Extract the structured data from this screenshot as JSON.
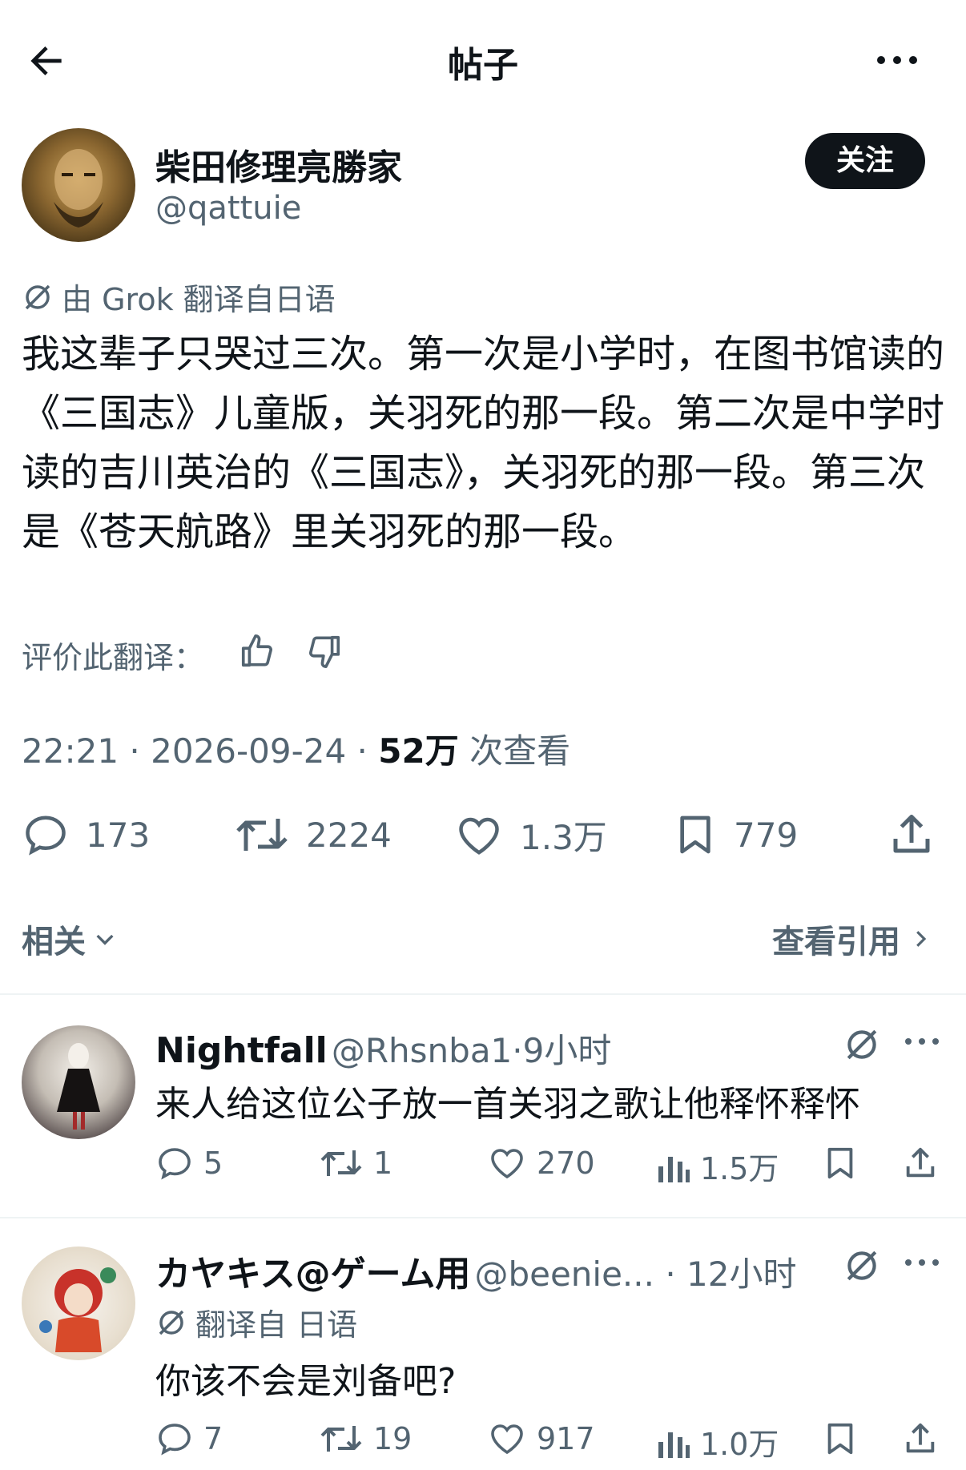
{
  "header": {
    "title": "帖子"
  },
  "author": {
    "name": "柴田修理亮勝家",
    "handle": "@qattuie",
    "follow_label": "关注"
  },
  "translation_note": "由 Grok 翻译自日语",
  "tweet": {
    "text": "我这辈子只哭过三次。第一次是小学时，在图书馆读的《三国志》儿童版，关羽死的那一段。第二次是中学时读的吉川英治的《三国志》，关羽死的那一段。第三次是《苍天航路》里关羽死的那一段。",
    "rate_label": "评价此翻译：",
    "time": "22:21",
    "date": "2026-09-24",
    "views": "52万",
    "views_label": "次查看"
  },
  "stats": {
    "replies": "173",
    "retweets": "2224",
    "likes": "1.3万",
    "bookmarks": "779"
  },
  "related": {
    "label": "相关",
    "quotes_label": "查看引用"
  },
  "replies": [
    {
      "name": "Nightfall",
      "handle": "@Rhsnba1",
      "time": "9小时",
      "text": "来人给这位公子放一首关羽之歌让他释怀释怀",
      "stats": {
        "replies": "5",
        "retweets": "1",
        "likes": "270",
        "views": "1.5万"
      }
    },
    {
      "name": "カヤキス@ゲーム用",
      "handle": "@beenie...",
      "time": "12小时",
      "translation_note": "翻译自 日语",
      "text": "你该不会是刘备吧?",
      "stats": {
        "replies": "7",
        "retweets": "19",
        "likes": "917",
        "views": "1.0万"
      }
    }
  ],
  "colors": {
    "text": "#0f1419",
    "secondary": "#536471",
    "divider": "#eff3f4",
    "follow_bg": "#0f1419"
  }
}
